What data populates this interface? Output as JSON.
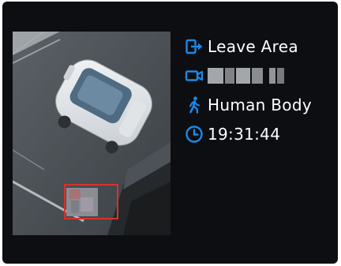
{
  "event": {
    "type_label": "Leave Area",
    "camera_label": "",
    "target_label": "Human Body",
    "time_label": "19:31:44"
  },
  "icons": {
    "event": "leave-area-icon",
    "camera": "camera-icon",
    "target": "walking-person-icon",
    "time": "clock-icon"
  },
  "colors": {
    "accent": "#1e88e5",
    "background": "#0d0e12",
    "detection_box": "#d8322c",
    "text": "#ffffff"
  }
}
